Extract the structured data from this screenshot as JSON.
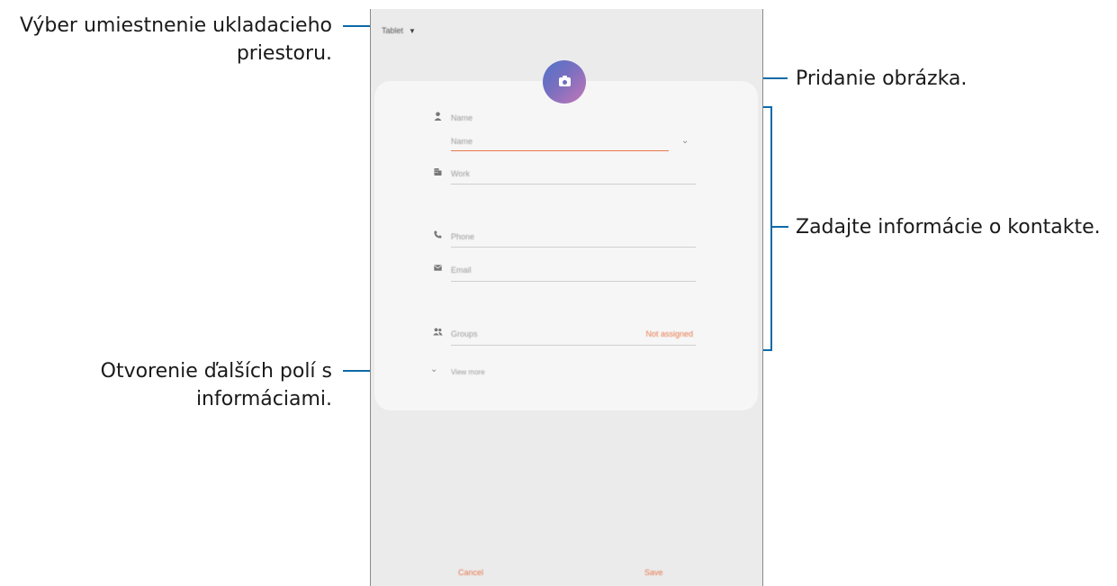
{
  "callouts": {
    "storage": [
      "Výber umiestnenie ukladacieho",
      "priestoru."
    ],
    "picture": "Pridanie obrázka.",
    "contact_info": "Zadajte informácie o kontakte.",
    "more_fields": [
      "Otvorenie ďalších polí s",
      "informáciami."
    ]
  },
  "phone": {
    "storage_label": "Tablet",
    "fields": {
      "name_header": "Name",
      "name_placeholder": "Name",
      "work": "Work",
      "phone": "Phone",
      "email": "Email",
      "groups": "Groups",
      "groups_value": "Not assigned",
      "view_more": "View more"
    },
    "buttons": {
      "cancel": "Cancel",
      "save": "Save"
    }
  },
  "colors": {
    "callout_line": "#0d6aa8",
    "accent": "#e8794d",
    "avatar_gradient_start": "#4f73c8",
    "avatar_gradient_end": "#c477b8"
  },
  "icons": {
    "person": "person-icon",
    "work": "building-icon",
    "phone": "phone-icon",
    "email": "email-icon",
    "groups": "group-icon",
    "camera": "camera-icon"
  }
}
